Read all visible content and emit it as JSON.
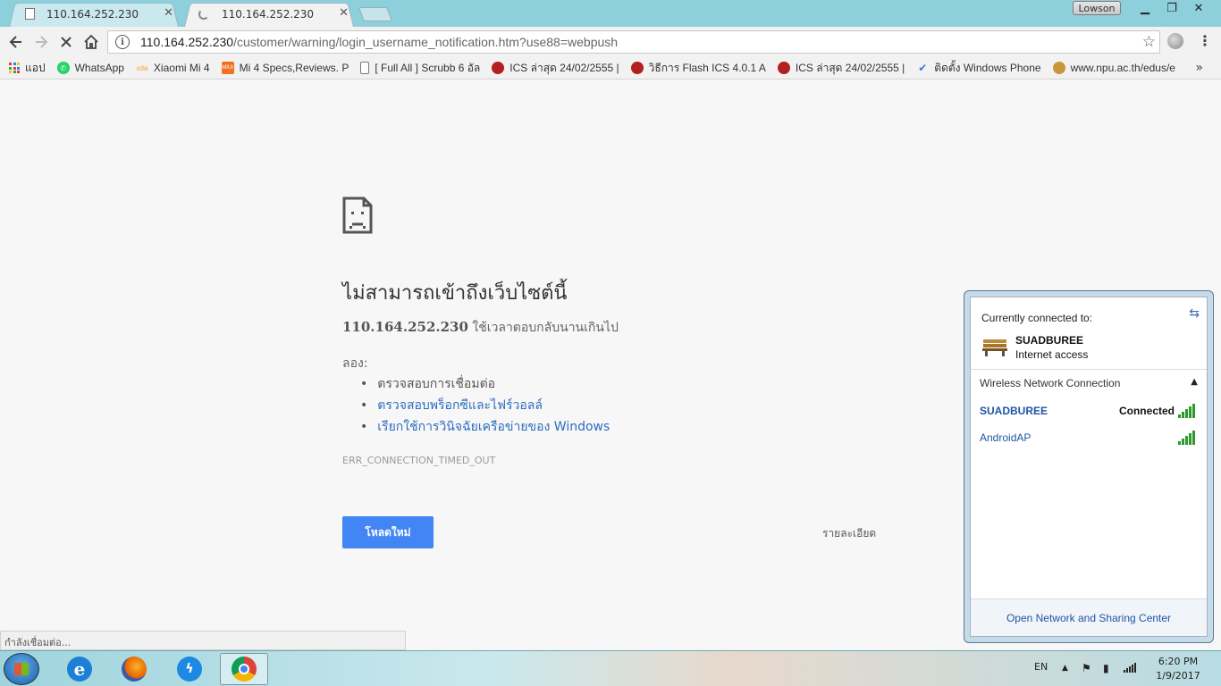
{
  "browser": {
    "tabs": [
      {
        "title": "110.164.252.230",
        "active": false
      },
      {
        "title": "110.164.252.230",
        "active": true
      }
    ],
    "profile_name": "Lowson",
    "url_host": "110.164.252.230",
    "url_path": "/customer/warning/login_username_notification.htm?use88=webpush"
  },
  "bookmarks": [
    {
      "label": "แอป",
      "icon": "apps-grid-icon"
    },
    {
      "label": "WhatsApp",
      "icon": "whatsapp-icon",
      "color": "#25d366"
    },
    {
      "label": "Xiaomi Mi 4",
      "icon": "xda-icon",
      "glyph": "xda",
      "color": "#f5a623"
    },
    {
      "label": "Mi 4 Specs,Reviews. P",
      "icon": "miui-icon",
      "glyph": "MIUI",
      "color": "#f36f21"
    },
    {
      "label": "[ Full All ] Scrubb 6 อัล",
      "icon": "page-icon"
    },
    {
      "label": "ICS ล่าสุด 24/02/2555 |",
      "icon": "ics-icon",
      "color": "#b32020"
    },
    {
      "label": "วิธีการ Flash ICS 4.0.1 A",
      "icon": "ics-icon",
      "color": "#b32020"
    },
    {
      "label": "ICS ล่าสุด 24/02/2555 |",
      "icon": "ics-icon",
      "color": "#b32020"
    },
    {
      "label": "ติดตั้ง Windows Phone",
      "icon": "windows-phone-icon",
      "color": "#3a7bd5"
    },
    {
      "label": "www.npu.ac.th/edus/e",
      "icon": "npu-icon",
      "color": "#c8963e"
    }
  ],
  "error": {
    "title": "ไม่สามารถเข้าถึงเว็บไซต์นี้",
    "host": "110.164.252.230",
    "message": "ใช้เวลาตอบกลับนานเกินไป",
    "try_label": "ลอง:",
    "suggestions": [
      {
        "text": "ตรวจสอบการเชื่อมต่อ",
        "link": false
      },
      {
        "text": "ตรวจสอบพร็อกซีและไฟร์วอลล์",
        "link": true
      },
      {
        "text": "เรียกใช้การวินิจฉัยเครือข่ายของ Windows",
        "link": true
      }
    ],
    "code": "ERR_CONNECTION_TIMED_OUT",
    "reload_label": "โหลดใหม่",
    "details_label": "รายละเอียด"
  },
  "status_bar": "กำลังเชื่อมต่อ...",
  "network_popup": {
    "current_label": "Currently connected to:",
    "current_network": "SUADBUREE",
    "current_access": "Internet access",
    "section_label": "Wireless Network Connection",
    "networks": [
      {
        "ssid": "SUADBUREE",
        "status": "Connected",
        "signal": 1.0
      },
      {
        "ssid": "AndroidAP",
        "status": "",
        "signal": 1.0
      }
    ],
    "footer_link": "Open Network and Sharing Center"
  },
  "taskbar": {
    "apps": [
      "internet-explorer-icon",
      "firefox-icon",
      "messenger-icon",
      "chrome-icon"
    ],
    "language": "EN",
    "time": "6:20 PM",
    "date": "1/9/2017"
  }
}
